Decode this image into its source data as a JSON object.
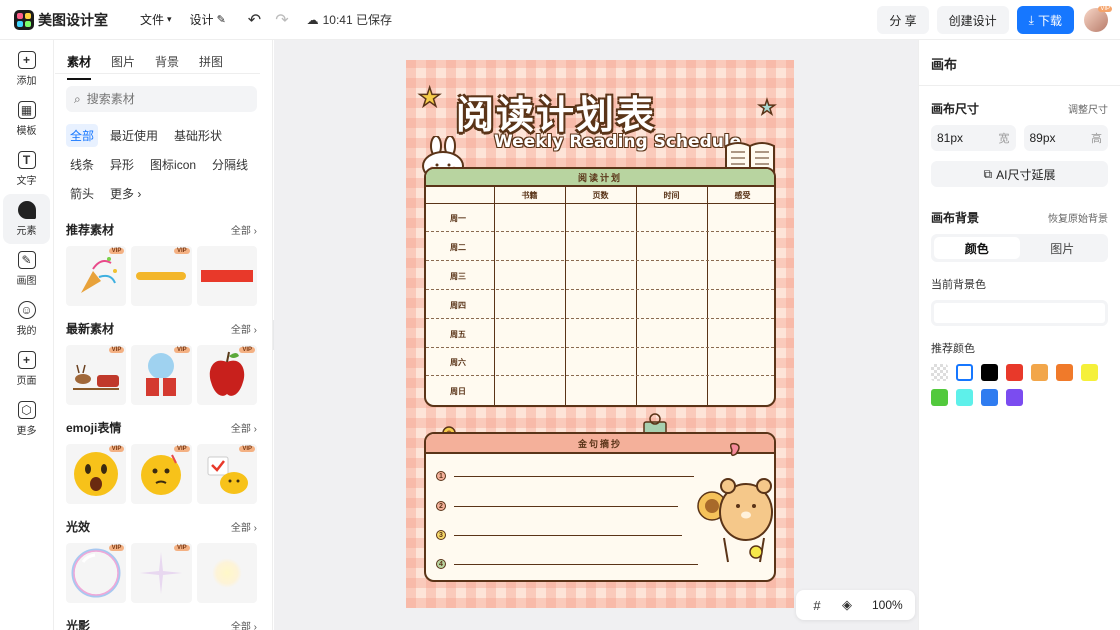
{
  "app": {
    "name": "美图设计室"
  },
  "topbar": {
    "menu_file": "文件",
    "menu_design": "设计",
    "saved_status": "10:41 已保存",
    "share_label": "分 享",
    "create_label": "创建设计",
    "download_label": "下载",
    "avatar_badge": "VIP"
  },
  "rail": [
    {
      "icon": "plus-square-icon",
      "glyph": "+",
      "label": "添加"
    },
    {
      "icon": "template-icon",
      "glyph": "▦",
      "label": "模板"
    },
    {
      "icon": "text-icon",
      "glyph": "T",
      "label": "文字"
    },
    {
      "icon": "shapes-icon",
      "glyph": "◆",
      "label": "元素"
    },
    {
      "icon": "brush-icon",
      "glyph": "✎",
      "label": "画图"
    },
    {
      "icon": "user-icon",
      "glyph": "☺",
      "label": "我的"
    },
    {
      "icon": "page-add-icon",
      "glyph": "+",
      "label": "页面"
    },
    {
      "icon": "cube-icon",
      "glyph": "⬡",
      "label": "更多"
    }
  ],
  "left_panel": {
    "tabs": [
      "素材",
      "图片",
      "背景",
      "拼图"
    ],
    "search_placeholder": "搜索素材",
    "chips": [
      "全部",
      "最近使用",
      "基础形状",
      "线条",
      "异形",
      "图标icon",
      "分隔线",
      "箭头",
      "更多"
    ],
    "see_all": "全部",
    "vip": "VIP",
    "sections": [
      {
        "title": "推荐素材"
      },
      {
        "title": "最新素材"
      },
      {
        "title": "emoji表情"
      },
      {
        "title": "光效"
      },
      {
        "title": "光影"
      }
    ]
  },
  "poster": {
    "title": "阅读计划表",
    "subtitle": "Weekly Reading Schedule",
    "plan_header": "阅读计划",
    "columns": [
      "书籍",
      "页数",
      "时间",
      "感受"
    ],
    "days": [
      "周一",
      "周二",
      "周三",
      "周四",
      "周五",
      "周六",
      "周日"
    ],
    "quotes_header": "金句摘抄",
    "quote_numbers": [
      "1",
      "2",
      "3",
      "4"
    ]
  },
  "zoom": {
    "value": "100%"
  },
  "right_panel": {
    "title": "画布",
    "size_label": "画布尺寸",
    "resize_link": "调整尺寸",
    "width_value": "81px",
    "width_unit": "宽",
    "height_value": "89px",
    "height_unit": "高",
    "ai_extend_label": "AI尺寸延展",
    "bg_label": "画布背景",
    "restore_link": "恢复原始背景",
    "seg_color": "颜色",
    "seg_image": "图片",
    "current_bg_label": "当前背景色",
    "recommended_label": "推荐颜色",
    "swatches": [
      "transparent",
      "#ffffff",
      "#000000",
      "#e8392a",
      "#f2a64a",
      "#f07a2a",
      "#f5f03a",
      "#52c93c",
      "#5ef0ea",
      "#2f7cf0",
      "#7b4cf0"
    ]
  }
}
